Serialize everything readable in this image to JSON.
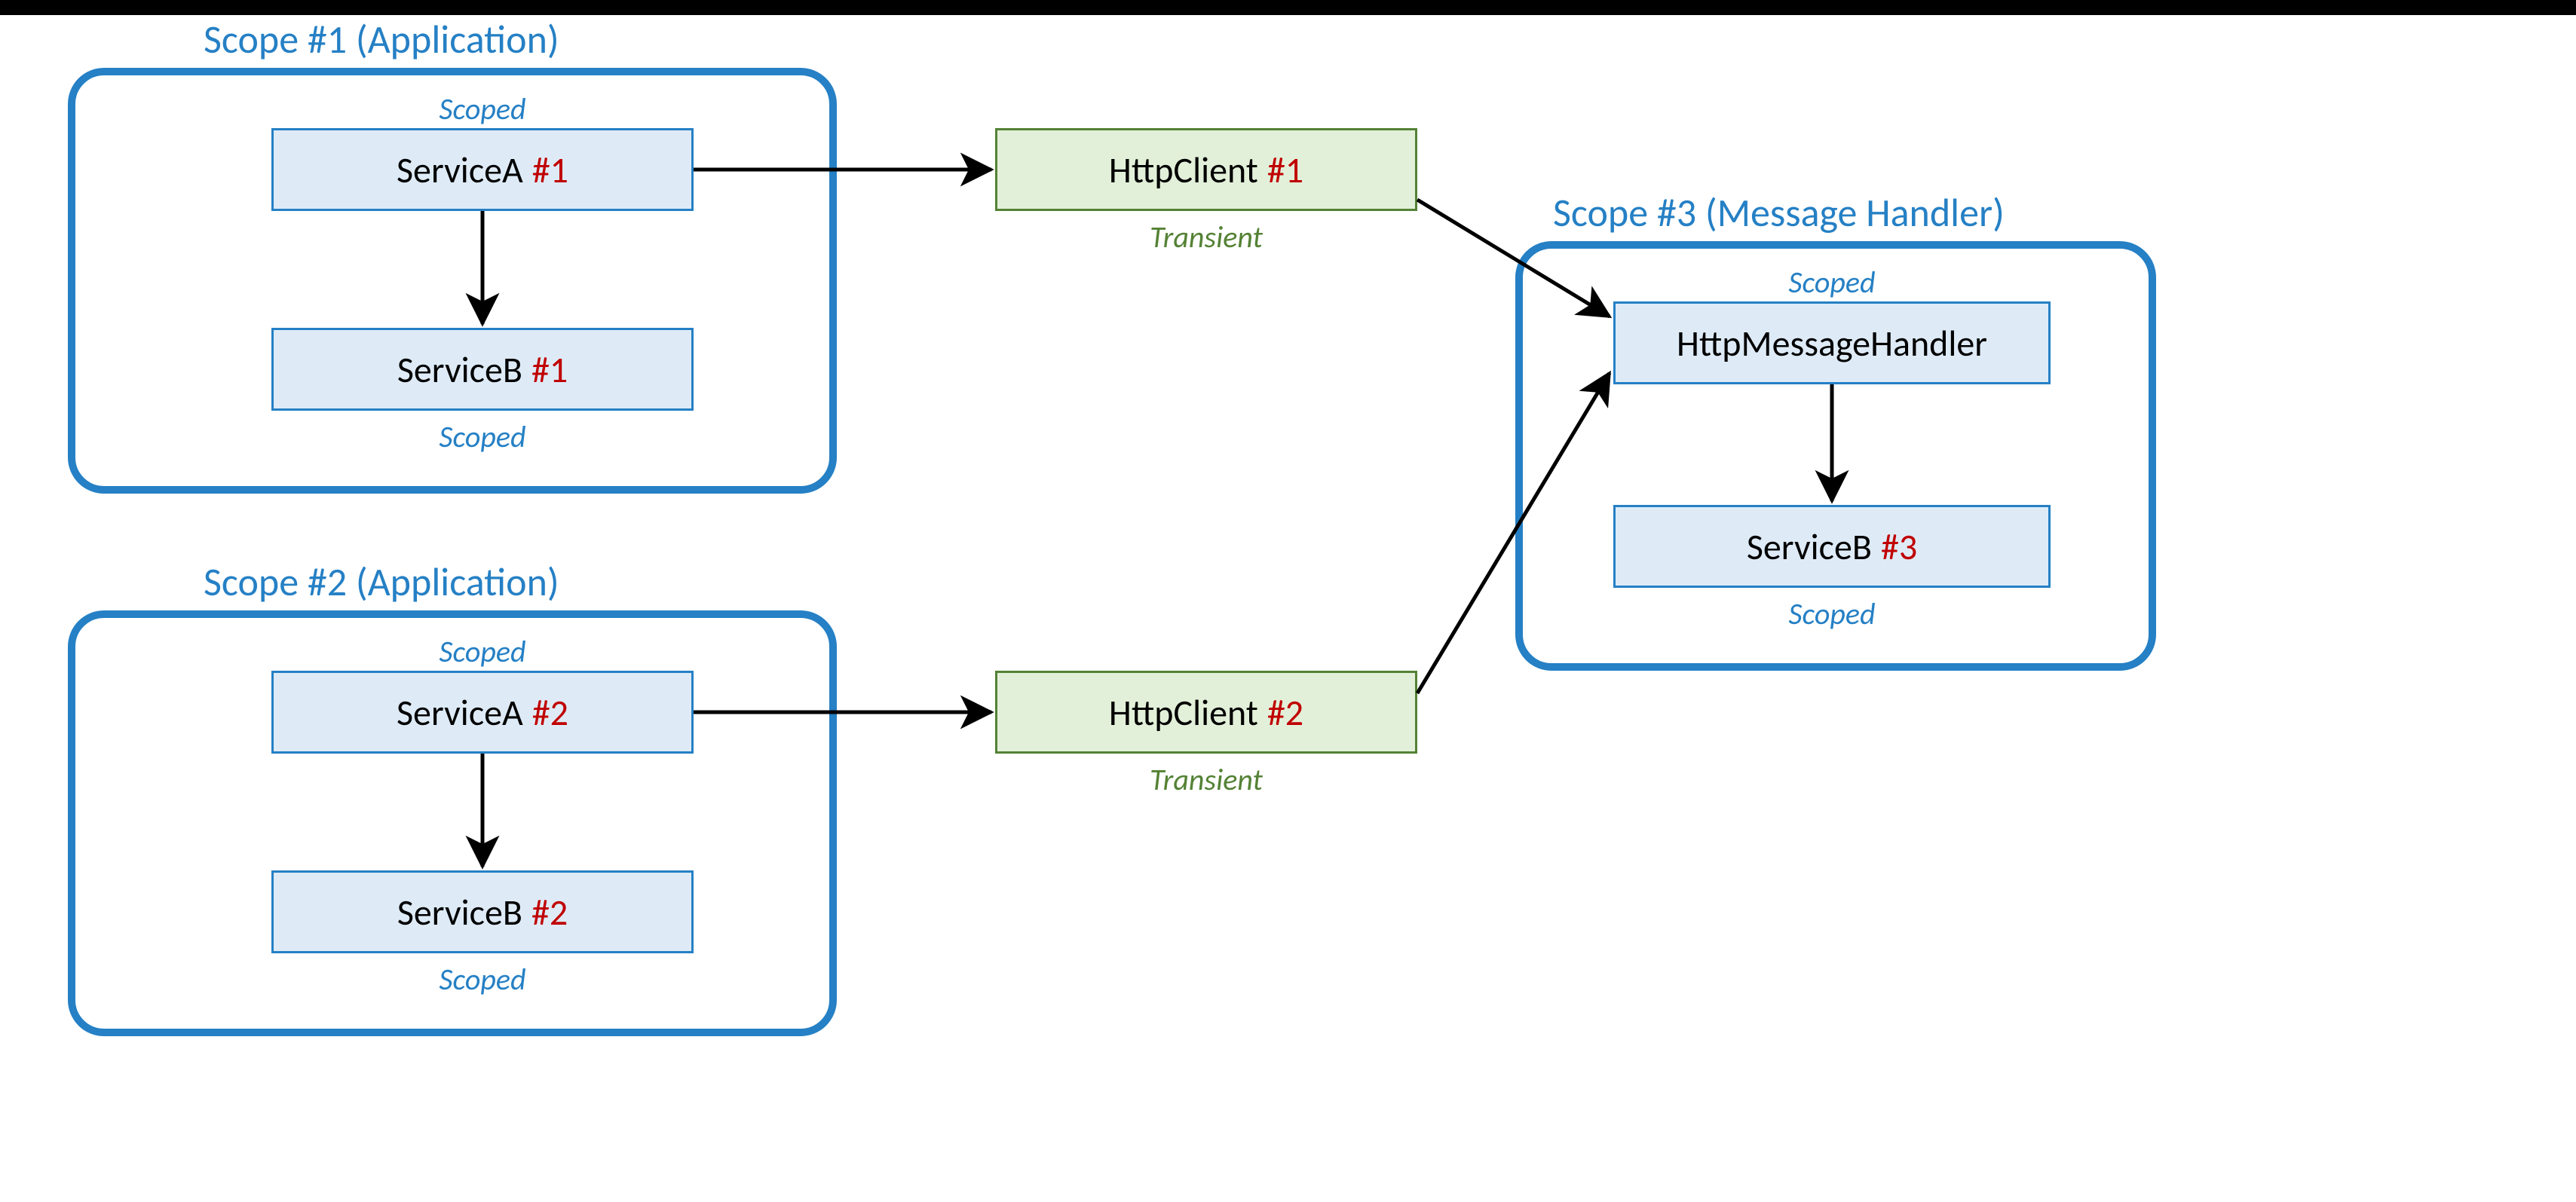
{
  "scopes": {
    "s1": {
      "title": "Scope #1 (Application)"
    },
    "s2": {
      "title": "Scope #2 (Application)"
    },
    "s3": {
      "title": "Scope #3 (Message Handler)"
    }
  },
  "entities": {
    "serviceA1": {
      "name": "ServiceA",
      "inst": "#1",
      "lifetime": "Scoped"
    },
    "serviceB1": {
      "name": "ServiceB",
      "inst": "#1",
      "lifetime": "Scoped"
    },
    "serviceA2": {
      "name": "ServiceA",
      "inst": "#2",
      "lifetime": "Scoped"
    },
    "serviceB2": {
      "name": "ServiceB",
      "inst": "#2",
      "lifetime": "Scoped"
    },
    "httpClient1": {
      "name": "HttpClient",
      "inst": "#1",
      "lifetime": "Transient"
    },
    "httpClient2": {
      "name": "HttpClient",
      "inst": "#2",
      "lifetime": "Transient"
    },
    "handler": {
      "name": "HttpMessageHandler",
      "inst": "",
      "lifetime": "Scoped"
    },
    "serviceB3": {
      "name": "ServiceB",
      "inst": "#3",
      "lifetime": "Scoped"
    }
  },
  "chart_data": {
    "type": "diagram",
    "title": "",
    "nodes": [
      {
        "id": "scope1",
        "label": "Scope #1 (Application)",
        "kind": "scope"
      },
      {
        "id": "scope2",
        "label": "Scope #2 (Application)",
        "kind": "scope"
      },
      {
        "id": "scope3",
        "label": "Scope #3 (Message Handler)",
        "kind": "scope"
      },
      {
        "id": "serviceA1",
        "label": "ServiceA #1",
        "lifetime": "Scoped",
        "scope": "scope1"
      },
      {
        "id": "serviceB1",
        "label": "ServiceB #1",
        "lifetime": "Scoped",
        "scope": "scope1"
      },
      {
        "id": "serviceA2",
        "label": "ServiceA #2",
        "lifetime": "Scoped",
        "scope": "scope2"
      },
      {
        "id": "serviceB2",
        "label": "ServiceB #2",
        "lifetime": "Scoped",
        "scope": "scope2"
      },
      {
        "id": "httpClient1",
        "label": "HttpClient #1",
        "lifetime": "Transient",
        "scope": null
      },
      {
        "id": "httpClient2",
        "label": "HttpClient #2",
        "lifetime": "Transient",
        "scope": null
      },
      {
        "id": "handler",
        "label": "HttpMessageHandler",
        "lifetime": "Scoped",
        "scope": "scope3"
      },
      {
        "id": "serviceB3",
        "label": "ServiceB #3",
        "lifetime": "Scoped",
        "scope": "scope3"
      }
    ],
    "edges": [
      {
        "from": "serviceA1",
        "to": "serviceB1"
      },
      {
        "from": "serviceA1",
        "to": "httpClient1"
      },
      {
        "from": "serviceA2",
        "to": "serviceB2"
      },
      {
        "from": "serviceA2",
        "to": "httpClient2"
      },
      {
        "from": "httpClient1",
        "to": "handler"
      },
      {
        "from": "httpClient2",
        "to": "handler"
      },
      {
        "from": "handler",
        "to": "serviceB3"
      }
    ]
  }
}
